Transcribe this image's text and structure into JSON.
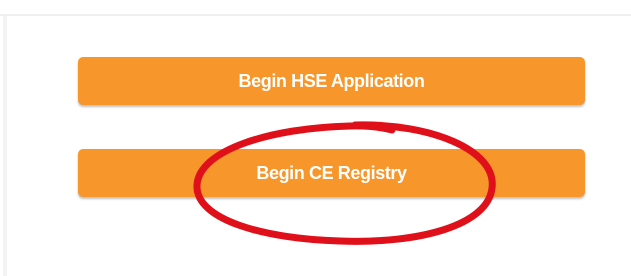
{
  "buttons": {
    "hse_label": "Begin HSE Application",
    "ce_label": "Begin CE Registry"
  },
  "colors": {
    "button_bg": "#f7962b",
    "button_text": "#ffffff",
    "annotation": "#e0101a"
  },
  "annotation": {
    "shape": "ellipse",
    "target": "Begin CE Registry"
  }
}
